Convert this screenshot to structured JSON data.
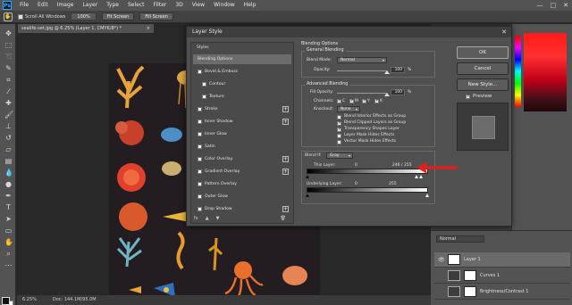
{
  "app": {
    "logo": "Ps"
  },
  "menu": [
    "File",
    "Edit",
    "Image",
    "Layer",
    "Type",
    "Select",
    "Filter",
    "3D",
    "View",
    "Window",
    "Help"
  ],
  "window_controls": [
    "—",
    "□",
    "✕"
  ],
  "options_bar": {
    "scroll_all_label": "Scroll All Windows",
    "zoom_value": "100%",
    "fit_screen_label": "Fit Screen",
    "fill_screen_label": "Fill Screen"
  },
  "document": {
    "tab_title": "sealife-set.jpg @ 6.25% (Layer 1, CMYK/8*) *",
    "tab_close": "×",
    "zoom_status": "6.25%",
    "doc_size": "Doc: 144.1M/95.0M"
  },
  "dialog": {
    "title": "Layer Style",
    "close": "✕",
    "styles_header": "Styles",
    "styles": [
      {
        "label": "Blending Options",
        "checkbox": false,
        "plus": false,
        "selected": true,
        "indent": false
      },
      {
        "label": "Bevel & Emboss",
        "checkbox": true,
        "plus": false,
        "selected": false,
        "indent": false
      },
      {
        "label": "Contour",
        "checkbox": true,
        "plus": false,
        "selected": false,
        "indent": true
      },
      {
        "label": "Texture",
        "checkbox": true,
        "plus": false,
        "selected": false,
        "indent": true
      },
      {
        "label": "Stroke",
        "checkbox": true,
        "plus": true,
        "selected": false,
        "indent": false
      },
      {
        "label": "Inner Shadow",
        "checkbox": true,
        "plus": true,
        "selected": false,
        "indent": false
      },
      {
        "label": "Inner Glow",
        "checkbox": true,
        "plus": false,
        "selected": false,
        "indent": false
      },
      {
        "label": "Satin",
        "checkbox": true,
        "plus": false,
        "selected": false,
        "indent": false
      },
      {
        "label": "Color Overlay",
        "checkbox": true,
        "plus": true,
        "selected": false,
        "indent": false
      },
      {
        "label": "Gradient Overlay",
        "checkbox": true,
        "plus": true,
        "selected": false,
        "indent": false
      },
      {
        "label": "Pattern Overlay",
        "checkbox": true,
        "plus": false,
        "selected": false,
        "indent": false
      },
      {
        "label": "Outer Glow",
        "checkbox": true,
        "plus": false,
        "selected": false,
        "indent": false
      },
      {
        "label": "Drop Shadow",
        "checkbox": true,
        "plus": true,
        "selected": false,
        "indent": false
      }
    ],
    "footer_icons": [
      "fx",
      "▲",
      "▼",
      "🗑"
    ],
    "blending": {
      "section_title": "Blending Options",
      "general_title": "General Blending",
      "blend_mode_label": "Blend Mode:",
      "blend_mode_value": "Normal",
      "opacity_label": "Opacity:",
      "opacity_value": "100",
      "opacity_unit": "%",
      "opacity_fraction": 1.0,
      "advanced_title": "Advanced Blending",
      "fill_opacity_label": "Fill Opacity:",
      "fill_opacity_value": "100",
      "fill_opacity_unit": "%",
      "fill_opacity_fraction": 1.0,
      "channels_label": "Channels:",
      "channels": [
        "C",
        "M",
        "Y",
        "K"
      ],
      "knockout_label": "Knockout:",
      "knockout_value": "None",
      "options": [
        {
          "label": "Blend Interior Effects as Group",
          "checked": false
        },
        {
          "label": "Blend Clipped Layers as Group",
          "checked": true
        },
        {
          "label": "Transparency Shapes Layer",
          "checked": true
        },
        {
          "label": "Layer Mask Hides Effects",
          "checked": false
        },
        {
          "label": "Vector Mask Hides Effects",
          "checked": false
        }
      ],
      "blend_if_label": "Blend If:",
      "blend_if_value": "Gray",
      "this_layer_label": "This Layer:",
      "this_layer_min": "0",
      "this_layer_max": "246 / 255",
      "underlying_label": "Underlying Layer:",
      "underlying_min": "0",
      "underlying_max": "255"
    },
    "buttons": {
      "ok": "OK",
      "cancel": "Cancel",
      "new_style": "New Style...",
      "preview": "Preview",
      "preview_checked": true
    }
  },
  "layers_panel": {
    "blend_mode": "Normal",
    "layers": [
      {
        "name": "Layer 1",
        "selected": true,
        "kind": "pixel"
      },
      {
        "name": "Curves 1",
        "selected": false,
        "kind": "adjustment"
      },
      {
        "name": "Brightness/Contrast 1",
        "selected": false,
        "kind": "adjustment"
      }
    ]
  },
  "colors": {
    "annotation_arrow": "#e02020",
    "foreground": "#111111",
    "background": "#ffffff"
  }
}
